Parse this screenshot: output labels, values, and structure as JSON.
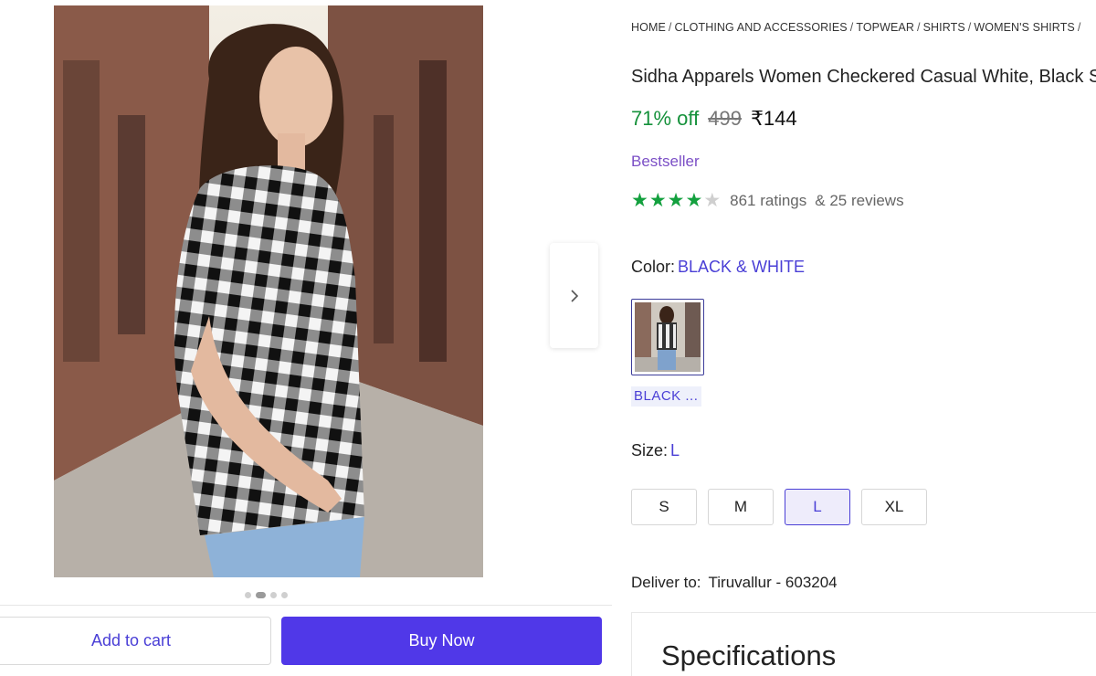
{
  "breadcrumb": [
    "HOME",
    "CLOTHING AND ACCESSORIES",
    "TOPWEAR",
    "SHIRTS",
    "WOMEN'S SHIRTS"
  ],
  "product": {
    "title": "Sidha Apparels Women Checkered Casual White, Black Shirt",
    "discount": "71% off",
    "mrp": "499",
    "price": "₹144",
    "badge": "Bestseller",
    "rating": {
      "stars": 4,
      "max": 5,
      "ratings_text": "861 ratings",
      "reviews_text": "& 25 reviews"
    }
  },
  "color": {
    "label": "Color:",
    "selected": "BLACK & WHITE",
    "swatch_label": "BLACK ..."
  },
  "size": {
    "label": "Size:",
    "selected": "L",
    "options": [
      "S",
      "M",
      "L",
      "XL"
    ]
  },
  "delivery": {
    "label": "Deliver to:",
    "location": "Tiruvallur - 603204"
  },
  "specifications": {
    "title": "Specifications"
  },
  "actions": {
    "add_to_cart": "Add to cart",
    "buy_now": "Buy Now"
  },
  "gallery": {
    "image_count": 4,
    "active_index": 1
  },
  "colors": {
    "accent": "#5038e8",
    "link": "#4a3fd6",
    "discount": "#15913b",
    "badge": "#7b4fc6",
    "star": "#13a03e"
  },
  "icons": {
    "next": "chevron-right-icon",
    "star": "star-icon"
  }
}
